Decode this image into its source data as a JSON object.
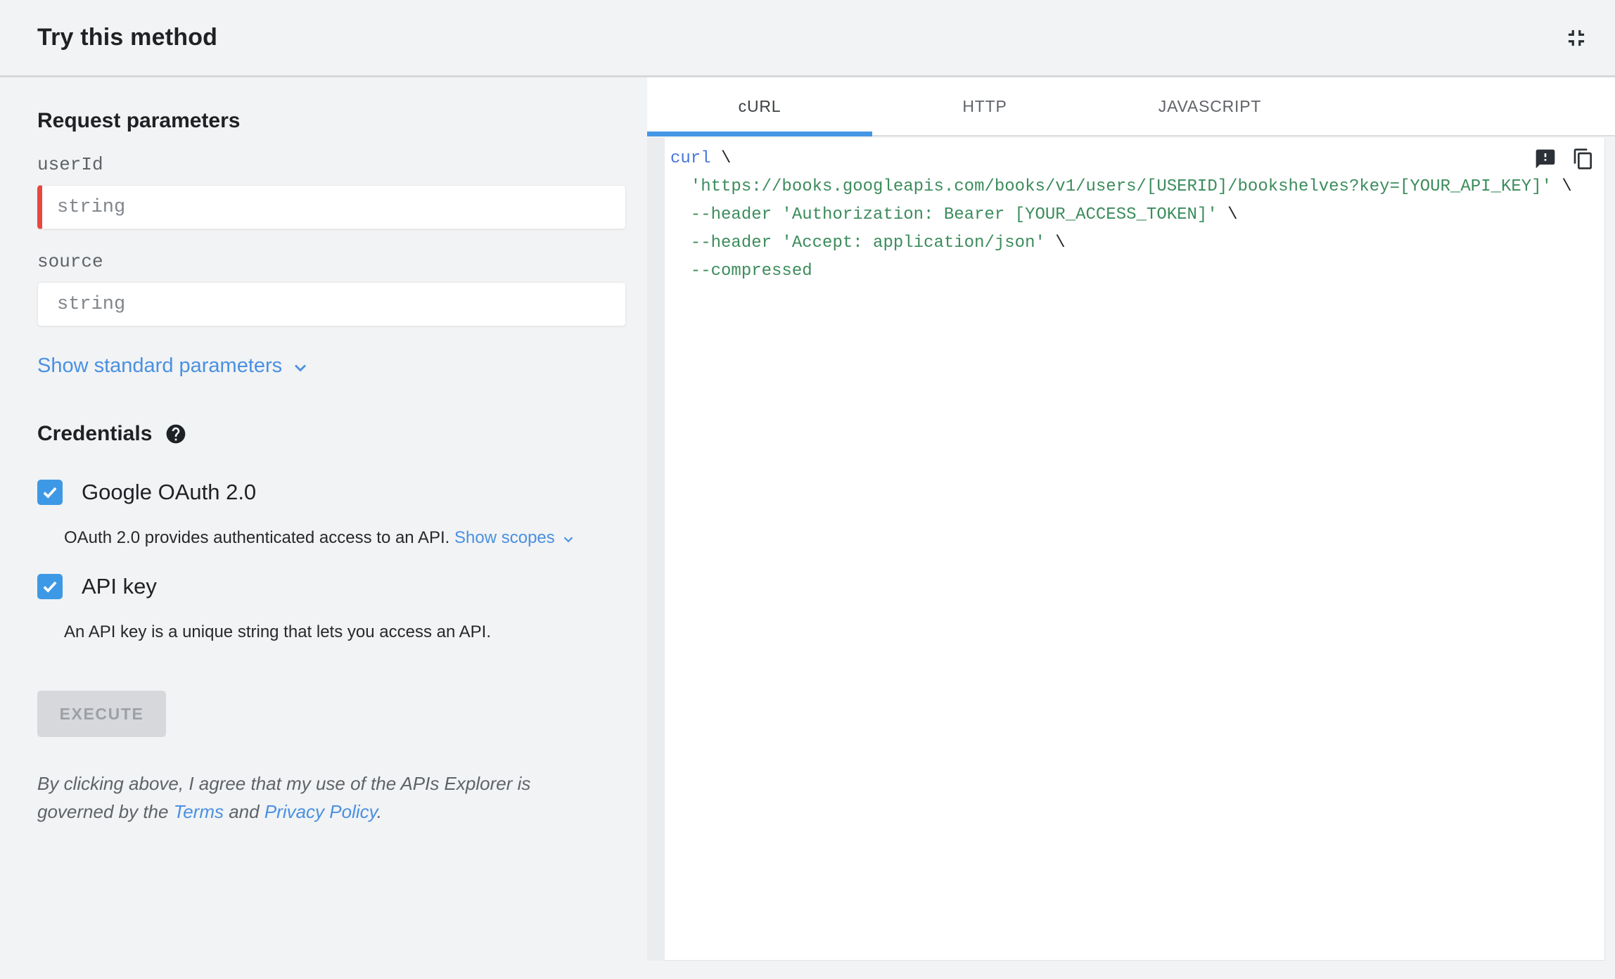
{
  "header": {
    "title": "Try this method"
  },
  "params": {
    "section_title": "Request parameters",
    "fields": [
      {
        "label": "userId",
        "placeholder": "string",
        "required": true
      },
      {
        "label": "source",
        "placeholder": "string",
        "required": false
      }
    ],
    "show_standard_label": "Show standard parameters"
  },
  "credentials": {
    "section_title": "Credentials",
    "items": [
      {
        "label": "Google OAuth 2.0",
        "checked": true,
        "description": "OAuth 2.0 provides authenticated access to an API. ",
        "link_label": "Show scopes"
      },
      {
        "label": "API key",
        "checked": true,
        "description": "An API key is a unique string that lets you access an API.",
        "link_label": ""
      }
    ]
  },
  "execute": {
    "label": "EXECUTE"
  },
  "terms": {
    "text_1": "By clicking above, I agree that my use of the APIs Explorer is governed by the ",
    "terms_link": "Terms",
    "text_2": " and ",
    "privacy_link": "Privacy Policy",
    "text_3": "."
  },
  "tabs": [
    {
      "label": "cURL",
      "active": true
    },
    {
      "label": "HTTP",
      "active": false
    },
    {
      "label": "JAVASCRIPT",
      "active": false
    }
  ],
  "code": {
    "language": "cURL",
    "lines": [
      {
        "s0": "curl",
        "s1": " \\"
      },
      {
        "s0": "  'https://books.googleapis.com/books/v1/users/[USERID]/bookshelves?key=[YOUR_API_KEY]'",
        "s1": " \\"
      },
      {
        "s0": "  --header 'Authorization: Bearer [YOUR_ACCESS_TOKEN]'",
        "s1": " \\"
      },
      {
        "s0": "  --header 'Accept: application/json'",
        "s1": " \\"
      },
      {
        "s0": "  --compressed",
        "s1": ""
      }
    ]
  },
  "icons": {
    "collapse": "fullscreen-exit",
    "help": "help-filled-circle",
    "checkmark": "check",
    "chevron": "chevron-down",
    "feedback": "feedback-bubble",
    "copy": "content-copy"
  },
  "colors": {
    "page_background": "#f1f3f4",
    "accent_blue_link": "#4a90e2",
    "checkbox_blue": "#3d99e5",
    "tab_underline_blue": "#4596e4",
    "required_red": "#e8473f",
    "code_command_blue": "#4878d8",
    "code_string_green": "#3c8c5c",
    "code_plain": "#202124"
  }
}
